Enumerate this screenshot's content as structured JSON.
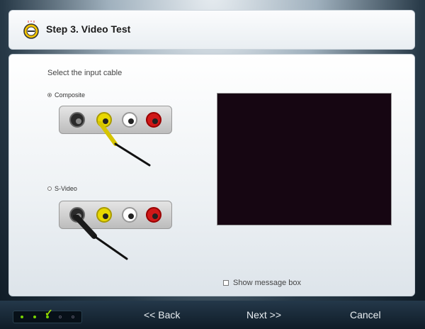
{
  "header": {
    "title": "Step 3. Video Test",
    "icon": "wizard-step-icon"
  },
  "content": {
    "instruction": "Select the input cable",
    "options": [
      {
        "label": "Composite",
        "selected": true
      },
      {
        "label": "S-Video",
        "selected": false
      }
    ],
    "message_box_label": "Show message box",
    "message_box_checked": false
  },
  "footer": {
    "back_label": "<< Back",
    "next_label": "Next >>",
    "cancel_label": "Cancel",
    "steps_total": 5,
    "steps_current": 3
  },
  "colors": {
    "preview_bg": "#160612",
    "progress_done": "#79d400"
  }
}
